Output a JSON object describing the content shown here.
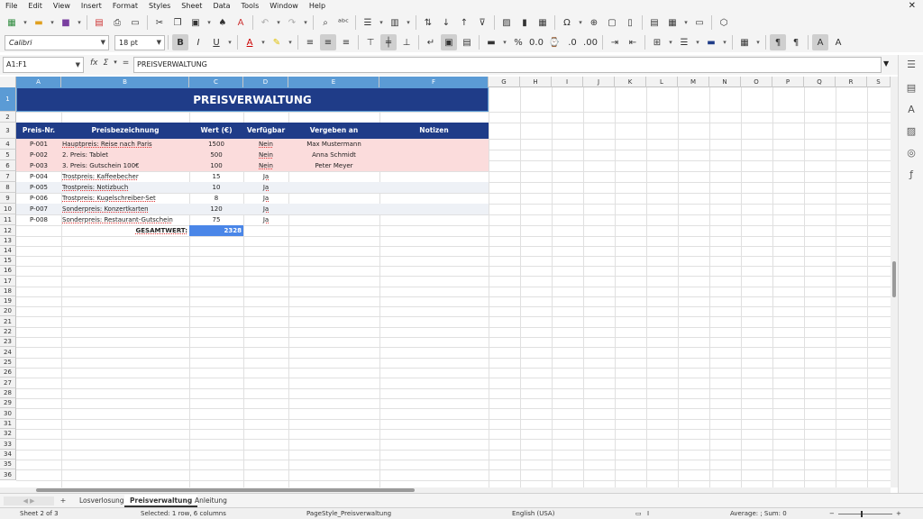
{
  "menu": [
    "File",
    "Edit",
    "View",
    "Insert",
    "Format",
    "Styles",
    "Sheet",
    "Data",
    "Tools",
    "Window",
    "Help"
  ],
  "toolbar": {
    "font_name": "Calibri",
    "font_size": "18 pt",
    "bold_label": "B",
    "italic_label": "I",
    "underline_label": "U"
  },
  "formula_bar": {
    "name_box": "A1:F1",
    "fx_label": "fx",
    "sum_label": "Σ",
    "equals_label": "=",
    "content": "PREISVERWALTUNG"
  },
  "columns": [
    "A",
    "B",
    "C",
    "D",
    "E",
    "F",
    "G",
    "H",
    "I",
    "J",
    "K",
    "L",
    "M",
    "N",
    "O",
    "P",
    "Q",
    "R",
    "S"
  ],
  "rows": [
    "1",
    "2",
    "3",
    "4",
    "5",
    "6",
    "7",
    "8",
    "9",
    "10",
    "11",
    "12",
    "13",
    "14",
    "15",
    "16",
    "17",
    "18",
    "19",
    "20",
    "21",
    "22",
    "23",
    "24",
    "25",
    "26",
    "27",
    "28",
    "29",
    "30",
    "31",
    "32",
    "33",
    "34",
    "35",
    "36"
  ],
  "sheet": {
    "title": "PREISVERWALTUNG",
    "headers": [
      "Preis-Nr.",
      "Preisbezeichnung",
      "Wert (€)",
      "Verfügbar",
      "Vergeben an",
      "Notizen"
    ],
    "data_rows": [
      {
        "nr": "P-001",
        "bez": "Hauptpreis: Reise nach Paris",
        "wert": "1500",
        "verf": "Nein",
        "an": "Max Mustermann",
        "notiz": ""
      },
      {
        "nr": "P-002",
        "bez": "2. Preis: Tablet",
        "wert": "500",
        "verf": "Nein",
        "an": "Anna Schmidt",
        "notiz": ""
      },
      {
        "nr": "P-003",
        "bez": "3. Preis: Gutschein 100€",
        "wert": "100",
        "verf": "Nein",
        "an": "Peter Meyer",
        "notiz": ""
      },
      {
        "nr": "P-004",
        "bez": "Trostpreis: Kaffeebecher",
        "wert": "15",
        "verf": "Ja",
        "an": "",
        "notiz": ""
      },
      {
        "nr": "P-005",
        "bez": "Trostpreis: Notizbuch",
        "wert": "10",
        "verf": "Ja",
        "an": "",
        "notiz": ""
      },
      {
        "nr": "P-006",
        "bez": "Trostpreis: Kugelschreiber-Set",
        "wert": "8",
        "verf": "Ja",
        "an": "",
        "notiz": ""
      },
      {
        "nr": "P-007",
        "bez": "Sonderpreis: Konzertkarten",
        "wert": "120",
        "verf": "Ja",
        "an": "",
        "notiz": ""
      },
      {
        "nr": "P-008",
        "bez": "Sonderpreis: Restaurant-Gutschein",
        "wert": "75",
        "verf": "Ja",
        "an": "",
        "notiz": ""
      }
    ],
    "total_label": "GESAMTWERT:",
    "total_value": "2328"
  },
  "tabs": {
    "add_label": "+",
    "items": [
      "Losverlosung",
      "Preisverwaltung",
      "Anleitung"
    ],
    "active": "Preisverwaltung"
  },
  "status": {
    "sheet": "Sheet 2 of 3",
    "selection": "Selected: 1 row, 6 columns",
    "page_style": "PageStyle_Preisverwaltung",
    "language": "English (USA)",
    "summary": "Average: ; Sum: 0"
  },
  "colors": {
    "header_blue": "#1f3c88",
    "selection_blue": "#5b9bd5",
    "taken_row": "#fbdcdc",
    "total_cell": "#4a86e8"
  }
}
